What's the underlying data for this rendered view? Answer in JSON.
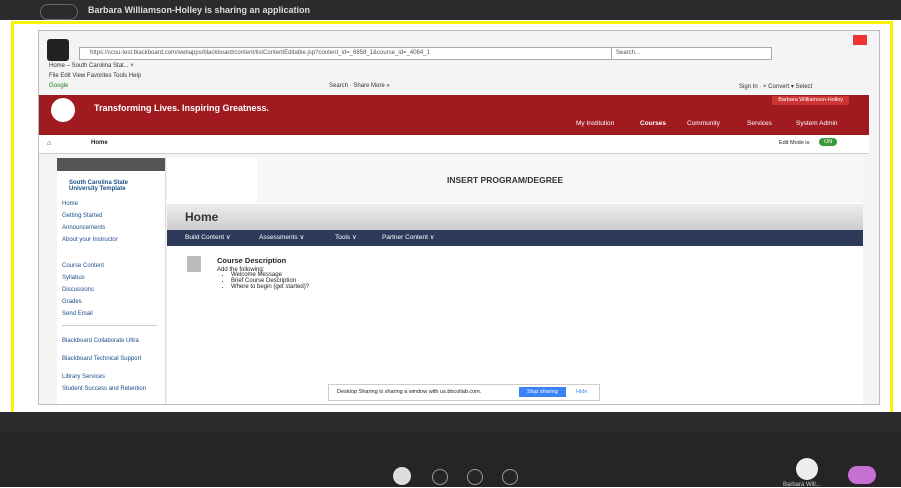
{
  "zoom": {
    "sharing_message": "Barbara Williamson-Holley is sharing an application",
    "share_notice": "Desktop Sharing is sharing a window with us.bbcollab.com.",
    "stop_sharing": "Stop sharing",
    "hide": "Hide",
    "presenter": "Barbara Will..."
  },
  "browser": {
    "url": "https://scsu-test.blackboard.com/webapps/blackboard/content/listContentEditable.jsp?content_id=_6858_1&course_id=_4084_1",
    "search_placeholder": "Search...",
    "tab": "Home – South Carolina Stat... ×",
    "menu": "File  Edit  View  Favorites  Tools  Help",
    "google": "Google",
    "toolbar": "Search ·  Share  More »",
    "signin": "Sign In  ·  ×   Convert  ▾  Select"
  },
  "bb": {
    "banner_title": "Transforming Lives. Inspiring Greatness.",
    "user": "Barbara Williamson-Holley",
    "nav": [
      "My Institution",
      "Courses",
      "Community",
      "Services",
      "System Admin"
    ],
    "crumb": "Home",
    "edit_mode": "Edit Mode is:",
    "on": "ON"
  },
  "left_menu": {
    "course": "South Carolina State University Template",
    "items_top": [
      "Home",
      "Getting Started",
      "Announcements",
      "About your Instructor"
    ],
    "items_mid": [
      "Course Content",
      "Syllabus",
      "Discussions",
      "Grades",
      "Send Email"
    ],
    "items_bot": [
      "Blackboard Collaborate Ultra",
      "Blackboard Technical Support",
      "Library Services",
      "Student Success and Retention"
    ]
  },
  "content": {
    "program_banner": "INSERT PROGRAM/DEGREE",
    "page_title": "Home",
    "actions": [
      "Build Content ∨",
      "Assessments ∨",
      "Tools ∨",
      "Partner Content ∨"
    ],
    "item_title": "Course Description",
    "item_sub": "Add the following:",
    "bullets": [
      "Welcome Message",
      "Brief Course Description",
      "Where to begin (get started)?"
    ]
  }
}
